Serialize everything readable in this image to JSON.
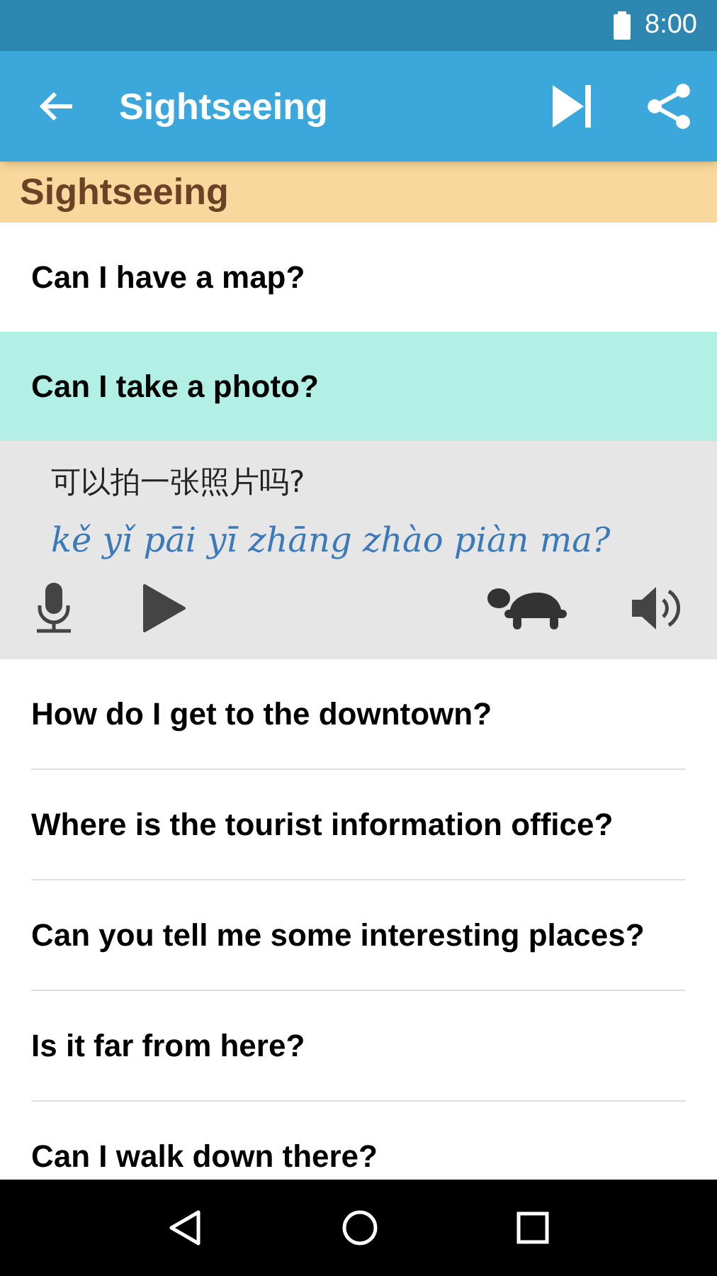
{
  "status_bar": {
    "time": "8:00"
  },
  "app_bar": {
    "title": "Sightseeing"
  },
  "section": {
    "title": "Sightseeing"
  },
  "phrases": [
    {
      "text": "Can I have a map?",
      "selected": false
    },
    {
      "text": "Can I take a photo?",
      "selected": true,
      "translation": "可以拍一张照片吗?",
      "pinyin": "kě yǐ pāi yī zhāng zhào piàn ma?"
    },
    {
      "text": "How do I get to the downtown?",
      "selected": false
    },
    {
      "text": "Where is the tourist information office?",
      "selected": false
    },
    {
      "text": "Can you tell me some interesting places?",
      "selected": false
    },
    {
      "text": "Is it far from here?",
      "selected": false
    },
    {
      "text": "Can I walk down there?",
      "selected": false
    }
  ]
}
